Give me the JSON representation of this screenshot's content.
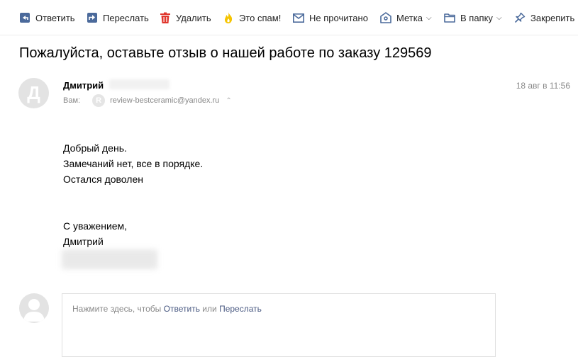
{
  "toolbar": {
    "reply": "Ответить",
    "forward": "Переслать",
    "delete": "Удалить",
    "spam": "Это спам!",
    "unread": "Не прочитано",
    "label": "Метка",
    "folder": "В папку",
    "pin": "Закрепить"
  },
  "message": {
    "subject": "Пожалуйста, оставьте отзыв о нашей работе по заказу 129569",
    "sender_initial": "Д",
    "sender_name": "Дмитрий",
    "to_label": "Вам:",
    "recipient_initial": "R",
    "recipient_address": "review-bestceramic@yandex.ru",
    "date": "18 авг в 11:56",
    "body": {
      "line1": "Добрый день.",
      "line2": "Замечаний нет, все в порядке.",
      "line3": "Остался доволен",
      "line4": "С уважением,",
      "line5": "Дмитрий"
    }
  },
  "reply": {
    "hint_prefix": "Нажмите здесь, чтобы",
    "reply_link": "Ответить",
    "or": "или",
    "forward_link": "Переслать"
  },
  "colors": {
    "icon_blue": "#4b6a9b",
    "delete_red": "#e0372e",
    "spam_yellow": "#f5c400",
    "link": "#4a5a82"
  }
}
